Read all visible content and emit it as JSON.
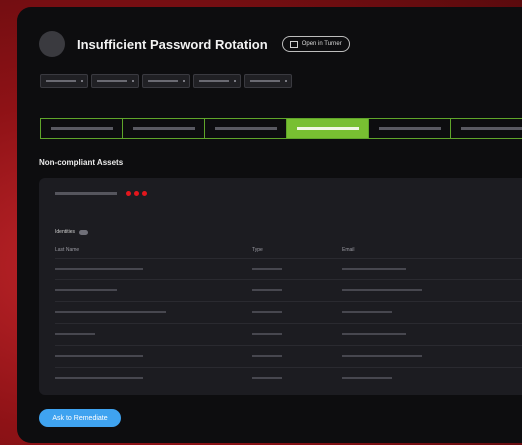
{
  "header": {
    "title": "Insufficient Password Rotation",
    "open_label": "Open in Turner"
  },
  "filters": {
    "count": 5
  },
  "tabs": {
    "count": 6,
    "active_index": 3
  },
  "section": {
    "title": "Non-compliant Assets"
  },
  "card": {
    "identities_label": "Identities",
    "columns": {
      "name": "Last Name",
      "type": "Type",
      "email": "Email"
    },
    "rows": [
      {
        "name": "",
        "type": "",
        "email": ""
      },
      {
        "name": "",
        "type": "",
        "email": ""
      },
      {
        "name": "",
        "type": "",
        "email": ""
      },
      {
        "name": "",
        "type": "",
        "email": ""
      },
      {
        "name": "",
        "type": "",
        "email": ""
      },
      {
        "name": "",
        "type": "",
        "email": ""
      }
    ]
  },
  "actions": {
    "remediate_label": "Ask to Remediate"
  },
  "colors": {
    "accent_green": "#78bf32",
    "button_blue": "#3fa3f0",
    "alert_red": "#e3161c"
  }
}
